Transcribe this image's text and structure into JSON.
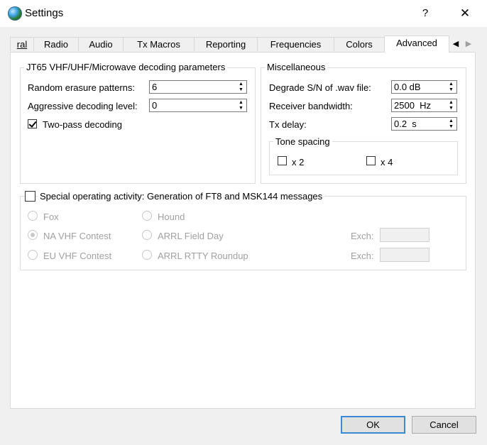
{
  "window": {
    "title": "Settings",
    "help_glyph": "?",
    "close_glyph": "✕",
    "app_icon": "globe-icon"
  },
  "tabs": [
    {
      "label": "ral",
      "active": false
    },
    {
      "label": "Radio",
      "active": false
    },
    {
      "label": "Audio",
      "active": false
    },
    {
      "label": "Tx Macros",
      "active": false
    },
    {
      "label": "Reporting",
      "active": false
    },
    {
      "label": "Frequencies",
      "active": false
    },
    {
      "label": "Colors",
      "active": false
    },
    {
      "label": "Advanced",
      "active": true
    }
  ],
  "tab_scroll": {
    "left": "◀",
    "right": "▶"
  },
  "jt65": {
    "title": "JT65 VHF/UHF/Microwave decoding parameters",
    "random_erasure_label": "Random erasure patterns:",
    "random_erasure_value": "6",
    "aggressive_label": "Aggressive decoding level:",
    "aggressive_value": "0",
    "two_pass_label": "Two-pass decoding",
    "two_pass_checked": true
  },
  "misc": {
    "title": "Miscellaneous",
    "degrade_label": "Degrade S/N of .wav file:",
    "degrade_value": "0.0 dB",
    "bandwidth_label": "Receiver bandwidth:",
    "bandwidth_value": "2500  Hz",
    "txdelay_label": "Tx delay:",
    "txdelay_value": "0.2  s",
    "tone_spacing": {
      "title": "Tone spacing",
      "x2_label": "x 2",
      "x2_checked": false,
      "x4_label": "x 4",
      "x4_checked": false
    }
  },
  "special": {
    "label": "Special operating activity:  Generation of FT8 and MSK144 messages",
    "checked": false,
    "fox": "Fox",
    "hound": "Hound",
    "na_vhf": "NA VHF Contest",
    "arrl_field": "ARRL Field Day",
    "eu_vhf": "EU VHF Contest",
    "arrl_rtty": "ARRL RTTY Roundup",
    "exch1_label": "Exch:",
    "exch1_value": "",
    "exch2_label": "Exch:",
    "exch2_value": "",
    "selected": "NA VHF Contest"
  },
  "buttons": {
    "ok": "OK",
    "cancel": "Cancel"
  },
  "colors": {
    "accent": "#3a8ad6",
    "disabled_text": "#a0a0a0"
  }
}
